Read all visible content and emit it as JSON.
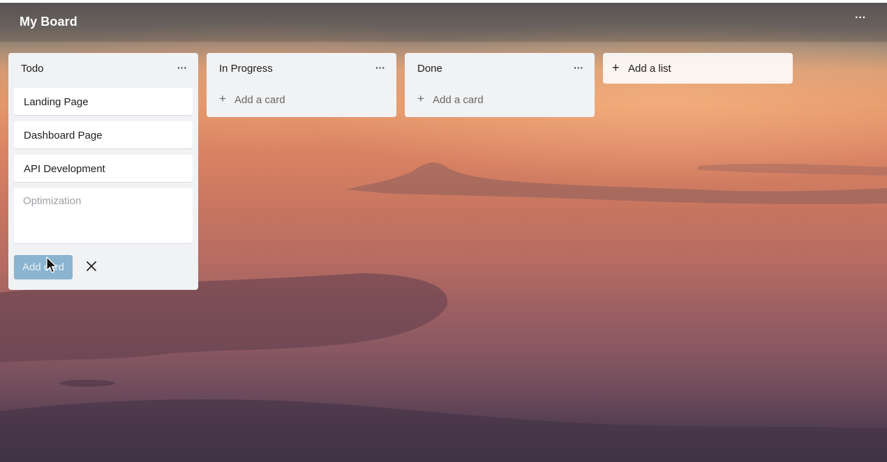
{
  "board": {
    "title": "My Board",
    "menu_glyph": "···"
  },
  "lists": [
    {
      "title": "Todo",
      "menu_glyph": "···",
      "cards": [
        "Landing Page",
        "Dashboard Page",
        "API Development"
      ],
      "composer": {
        "value": "",
        "placeholder": "Optimization",
        "submit_label": "Add card",
        "close_icon": "close-icon"
      }
    },
    {
      "title": "In Progress",
      "menu_glyph": "···",
      "add_card_label": "Add a card",
      "add_icon": "plus-icon"
    },
    {
      "title": "Done",
      "menu_glyph": "···",
      "add_card_label": "Add a card",
      "add_icon": "plus-icon"
    }
  ],
  "add_list": {
    "label": "Add a list",
    "icon": "plus-icon"
  },
  "colors": {
    "list_bg": "#f1f2f4",
    "card_bg": "#ffffff",
    "add_card_button": "#8ab4cf",
    "board_title": "#ffffff"
  }
}
